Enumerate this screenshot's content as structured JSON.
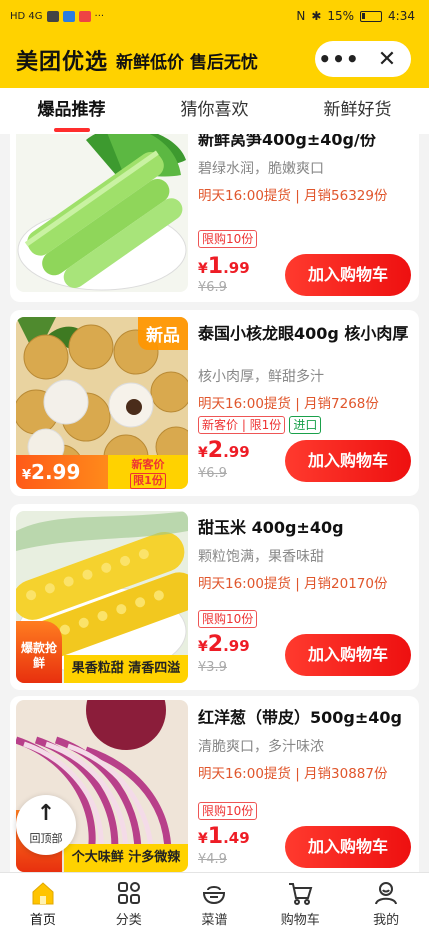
{
  "status_bar": {
    "left": "HD 4G",
    "battery": "15%",
    "time": "4:34"
  },
  "header": {
    "brand": "美团优选",
    "slogan": "新鲜低价 售后无忧",
    "more_label": "•••",
    "close_label": "✕"
  },
  "tabs": [
    {
      "label": "爆品推荐"
    },
    {
      "label": "猜你喜欢"
    },
    {
      "label": "新鲜好货"
    }
  ],
  "products": [
    {
      "title": "新鲜莴笋400g±40g/份",
      "desc": "碧绿水润，脆嫩爽口",
      "sales": "明天16:00提货 | 月销56329份",
      "tags": [
        "限购10份"
      ],
      "price_int": "1",
      "price_dec": ".99",
      "currency": "¥",
      "orig_price": "¥6.9",
      "button": "加入购物车"
    },
    {
      "title": "泰国小核龙眼400g 核小肉厚",
      "desc": "核小肉厚，鲜甜多汁",
      "sales": "明天16:00提货 | 月销7268份",
      "tags": [
        "新客价 | 限1份",
        "进口"
      ],
      "price_int": "2",
      "price_dec": ".99",
      "currency": "¥",
      "orig_price": "¥6.9",
      "button": "加入购物车",
      "badge": "新品",
      "strip_price": "2.99",
      "strip_label": "新客价",
      "strip_sub": "限1份"
    },
    {
      "title": "甜玉米 400g±40g",
      "desc": "颗粒饱满，果香味甜",
      "sales": "明天16:00提货 | 月销20170份",
      "tags": [
        "限购10份"
      ],
      "price_int": "2",
      "price_dec": ".99",
      "currency": "¥",
      "orig_price": "¥3.9",
      "button": "加入购物车",
      "flag": "爆款抢鲜",
      "strip_text": "果香粒甜 清香四溢"
    },
    {
      "title": "红洋葱（带皮）500g±40g",
      "desc": "清脆爽口，多汁味浓",
      "sales": "明天16:00提货 | 月销30887份",
      "tags": [
        "限购10份"
      ],
      "price_int": "1",
      "price_dec": ".49",
      "currency": "¥",
      "orig_price": "¥4.9",
      "button": "加入购物车",
      "flag": "抢鲜",
      "strip_text": "个大味鲜 汁多微辣"
    }
  ],
  "back_to_top": "回顶部",
  "bottom_nav": [
    {
      "label": "首页"
    },
    {
      "label": "分类"
    },
    {
      "label": "菜谱"
    },
    {
      "label": "购物车"
    },
    {
      "label": "我的"
    }
  ],
  "colors": {
    "brand_yellow": "#ffd200",
    "price_red": "#ee1c25",
    "button_red": "#ff2d2d"
  }
}
